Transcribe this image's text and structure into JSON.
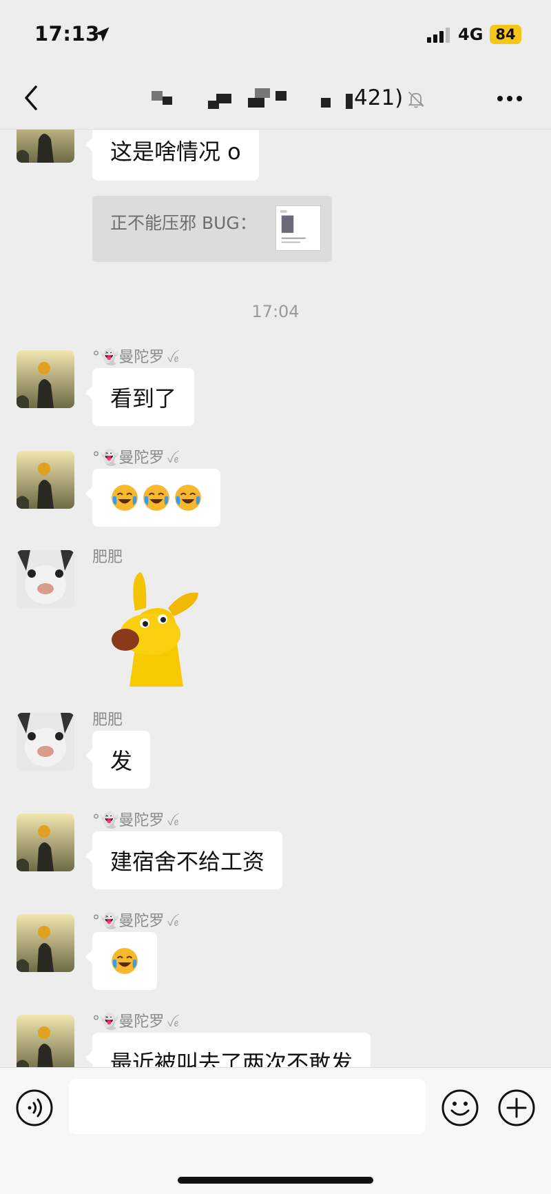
{
  "status_bar": {
    "time": "17:13",
    "network": "4G",
    "battery": "84",
    "battery_color": "#f5c518"
  },
  "nav": {
    "title_visible": "421)",
    "back_icon": "chevron-left-icon",
    "mute_icon": "bell-off-icon",
    "more_icon": "more-horizontal-icon"
  },
  "messages": [
    {
      "sender": "",
      "text": "这是啥情况 o",
      "quote": {
        "text": "正不能压邪 BUG："
      }
    },
    {
      "type": "timestamp",
      "text": "17:04"
    },
    {
      "sender": "°👻曼陀罗",
      "sender_deco": "ꪜꫀ",
      "text": "看到了"
    },
    {
      "sender": "°👻曼陀罗",
      "sender_deco": "ꪜꫀ",
      "emoji": [
        "face-with-tears-of-joy",
        "face-with-tears-of-joy",
        "face-with-tears-of-joy"
      ]
    },
    {
      "sender": "肥肥",
      "sticker": "yellow-dog-sticker"
    },
    {
      "sender": "肥肥",
      "text": "发"
    },
    {
      "sender": "°👻曼陀罗",
      "sender_deco": "ꪜꫀ",
      "text": "建宿舍不给工资"
    },
    {
      "sender": "°👻曼陀罗",
      "sender_deco": "ꪜꫀ",
      "emoji": [
        "face-with-tears-of-joy"
      ]
    },
    {
      "sender": "°👻曼陀罗",
      "sender_deco": "ꪜꫀ",
      "text": "最近被叫去了两次不敢发"
    }
  ],
  "input_bar": {
    "placeholder": "",
    "voice_icon": "voice-icon",
    "emoji_icon": "smiley-icon",
    "plus_icon": "plus-circle-icon"
  }
}
